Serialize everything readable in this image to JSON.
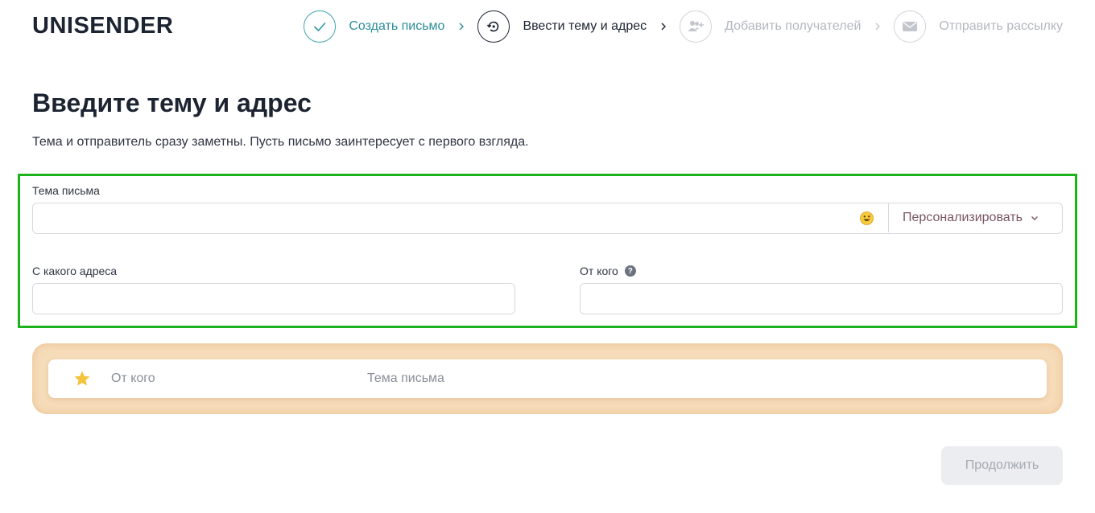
{
  "brand": {
    "logo_text": "UNISENDER"
  },
  "stepper": {
    "steps": [
      {
        "label": "Создать письмо",
        "state": "done",
        "icon": "check-icon"
      },
      {
        "label": "Ввести тему и адрес",
        "state": "active",
        "icon": "history-icon"
      },
      {
        "label": "Добавить получателей",
        "state": "todo",
        "icon": "add-users-icon"
      },
      {
        "label": "Отправить рассылку",
        "state": "todo",
        "icon": "envelope-icon"
      }
    ],
    "separator_icon": "chevron-right-icon"
  },
  "page": {
    "title": "Введите тему и адрес",
    "subtitle": "Тема и отправитель сразу заметны. Пусть письмо заинтересует с первого взгляда."
  },
  "form": {
    "subject": {
      "label": "Тема письма",
      "value": "",
      "placeholder": "",
      "emoji_icon": "emoji-smile-icon",
      "personalize_label": "Персонализировать"
    },
    "from_address": {
      "label": "С какого адреса",
      "value": "",
      "placeholder": ""
    },
    "from_name": {
      "label": "От кого",
      "value": "",
      "placeholder": "",
      "help_icon": "question-icon"
    }
  },
  "preview": {
    "star_icon": "star-icon",
    "from_label": "От кого",
    "subject_label": "Тема письма"
  },
  "actions": {
    "continue_label": "Продолжить"
  },
  "colors": {
    "brand_dark": "#1c2331",
    "step_done": "#2d8e99",
    "step_todo": "#b4b8c0",
    "highlight_border": "#1db31d",
    "preview_bg": "#f6dcb9",
    "star": "#f5c33b",
    "personalize_text": "#7a5562",
    "button_disabled_bg": "#ebedf0"
  }
}
